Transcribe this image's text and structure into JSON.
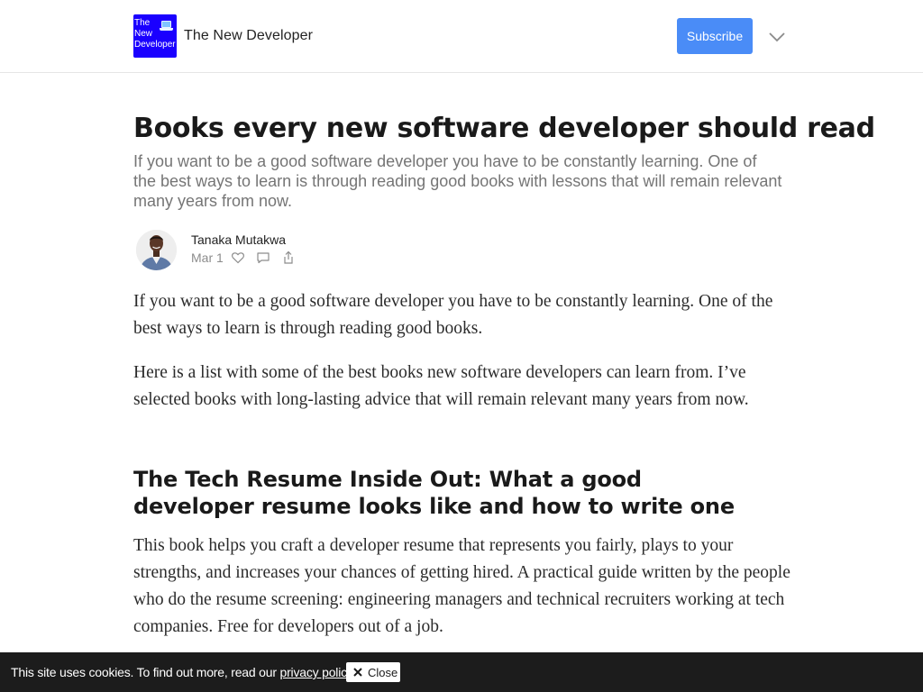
{
  "header": {
    "logo_lines": [
      "The",
      "New",
      "Developer"
    ],
    "publication_name": "The New Developer",
    "subscribe_label": "Subscribe",
    "menu_icon": "chevron-down-icon",
    "accent_color": "#4a8cf7",
    "logo_color": "#1a00ff"
  },
  "article": {
    "title": "Books every new software developer should read",
    "subtitle": "If you want to be a good software developer you have to be constantly learning. One of the best ways to learn is through reading good books with lessons that will remain relevant many years from now.",
    "author": "Tanaka Mutakwa",
    "date": "Mar 1",
    "actions": [
      "heart-icon",
      "comment-icon",
      "share-icon"
    ],
    "paragraph_1": "If you want to be a good software developer you have to be constantly learning. One of the best ways to learn is through reading good books.",
    "paragraph_2": "Here is a list with some of the best books new software developers can learn from. I’ve selected books with long-lasting advice that will remain relevant many years from now.",
    "section_heading": "The Tech Resume Inside Out: What a good developer resume looks like and how to write one",
    "paragraph_3": "This book helps you craft a developer resume that represents you fairly, plays to your strengths, and increases your chances of getting hired. A practical guide written by the people who do the resume screening: engineering managers and technical recruiters working at tech companies. Free for developers out of a job."
  },
  "cookie_banner": {
    "text": "This site uses cookies. To find out more, read our ",
    "link_text": "privacy policy",
    "close_label": "Close"
  }
}
